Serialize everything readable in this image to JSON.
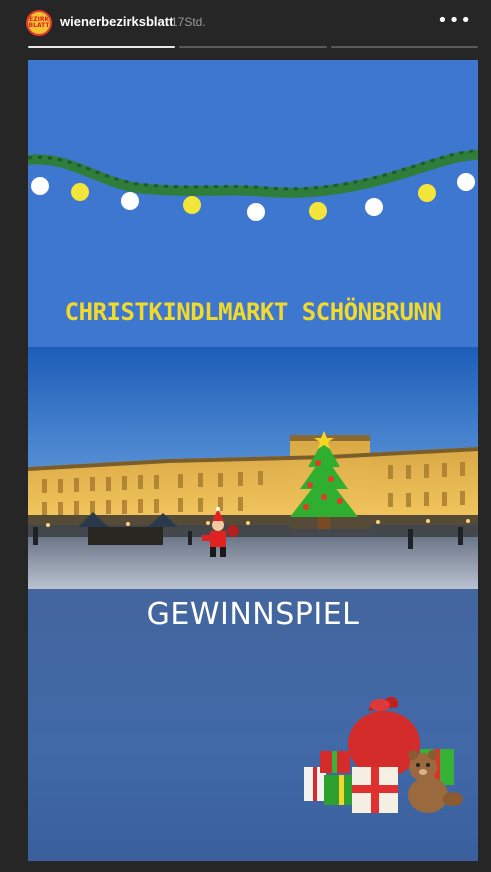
{
  "header": {
    "avatar_text": "BEZIRKS BLATT",
    "username": "wienerbezirksblatt",
    "time": "17Std.",
    "more_icon": "more-icon"
  },
  "progress": {
    "segments": 3,
    "current": 1
  },
  "story": {
    "title": "CHRISTKINDLMARKT SCHÖNBRUNN",
    "subtitle": "GEWINNSPIEL"
  },
  "colors": {
    "background": "#262626",
    "story_blue": "#3d77cf",
    "title_yellow": "#f2da2c",
    "bottom_blue": "#4169a8"
  }
}
